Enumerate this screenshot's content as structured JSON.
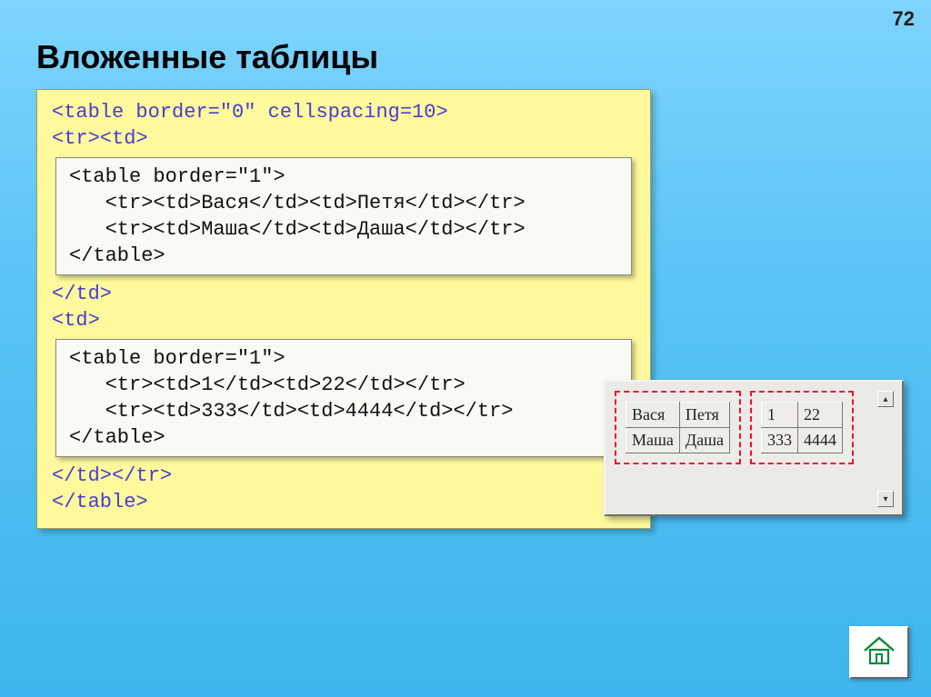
{
  "page_number": "72",
  "title": "Вложенные таблицы",
  "code": {
    "outer_top1": "<table border=\"0\" cellspacing=10>",
    "outer_top2": "<tr><td>",
    "inner1_l1": "<table border=\"1\">",
    "inner1_l2": "   <tr><td>Вася</td><td>Петя</td></tr>",
    "inner1_l3": "   <tr><td>Маша</td><td>Даша</td></tr>",
    "inner1_l4": "</table>",
    "mid1": "</td>",
    "mid2": "<td>",
    "inner2_l1": "<table border=\"1\">",
    "inner2_l2": "   <tr><td>1</td><td>22</td></tr>",
    "inner2_l3": "   <tr><td>333</td><td>4444</td></tr>",
    "inner2_l4": "</table>",
    "outer_bot1": "</td></tr>",
    "outer_bot2": "</table>"
  },
  "preview": {
    "table1": [
      [
        "Вася",
        "Петя"
      ],
      [
        "Маша",
        "Даша"
      ]
    ],
    "table2": [
      [
        "1",
        "22"
      ],
      [
        "333",
        "4444"
      ]
    ],
    "scroll_up": "▴",
    "scroll_down": "▾"
  }
}
